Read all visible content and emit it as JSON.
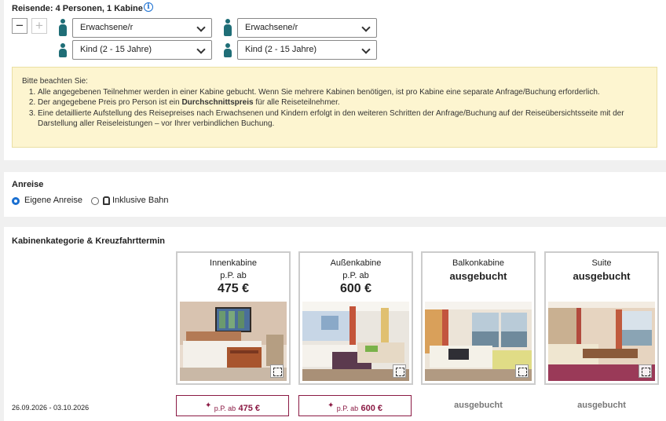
{
  "travelers": {
    "heading": "Reisende: 4 Personen, 1 Kabine",
    "minus": "−",
    "plus": "+",
    "selects": {
      "adult_a": "Erwachsene/r",
      "adult_b": "Erwachsene/r",
      "child_a": "Kind (2 - 15 Jahre)",
      "child_b": "Kind (2 - 15 Jahre)"
    }
  },
  "notice": {
    "intro": "Bitte beachten Sie:",
    "item1": "Alle angegebenen Teilnehmer werden in einer Kabine gebucht. Wenn Sie mehrere Kabinen benötigen, ist pro Kabine eine separate Anfrage/Buchung erforderlich.",
    "item2_pre": "Der angegebene Preis pro Person ist ein ",
    "item2_bold": "Durchschnittspreis",
    "item2_post": " für alle Reiseteilnehmer.",
    "item3": "Eine detaillierte Aufstellung des Reisepreises nach Erwachsenen und Kindern erfolgt in den weiteren Schritten der Anfrage/Buchung auf der Reiseübersichtsseite mit der Darstellung aller Reiseleistungen – vor Ihrer verbindlichen Buchung."
  },
  "arrival": {
    "heading": "Anreise",
    "option_own": "Eigene Anreise",
    "option_train": "Inklusive Bahn",
    "selected": "Eigene Anreise"
  },
  "cabins": {
    "heading": "Kabinenkategorie & Kreuzfahrttermin",
    "inside": {
      "title": "Innenkabine",
      "sub": "p.P. ab",
      "price": "475 €"
    },
    "outside": {
      "title": "Außenkabine",
      "sub": "p.P. ab",
      "price": "600 €"
    },
    "balcony": {
      "title": "Balkonkabine",
      "status": "ausgebucht"
    },
    "suite": {
      "title": "Suite",
      "status": "ausgebucht"
    },
    "row": {
      "date": "26.09.2026 - 03.10.2026",
      "sparkle": "✦",
      "pp_ab": "p.P. ab",
      "inside_price": "475 €",
      "outside_price": "600 €",
      "balcony": "ausgebucht",
      "suite": "ausgebucht"
    }
  },
  "colors": {
    "accent": "#1a6fd1",
    "person_icon": "#1f6e77",
    "price_border": "#8b1a44",
    "notice_bg": "#fdf5d0"
  }
}
